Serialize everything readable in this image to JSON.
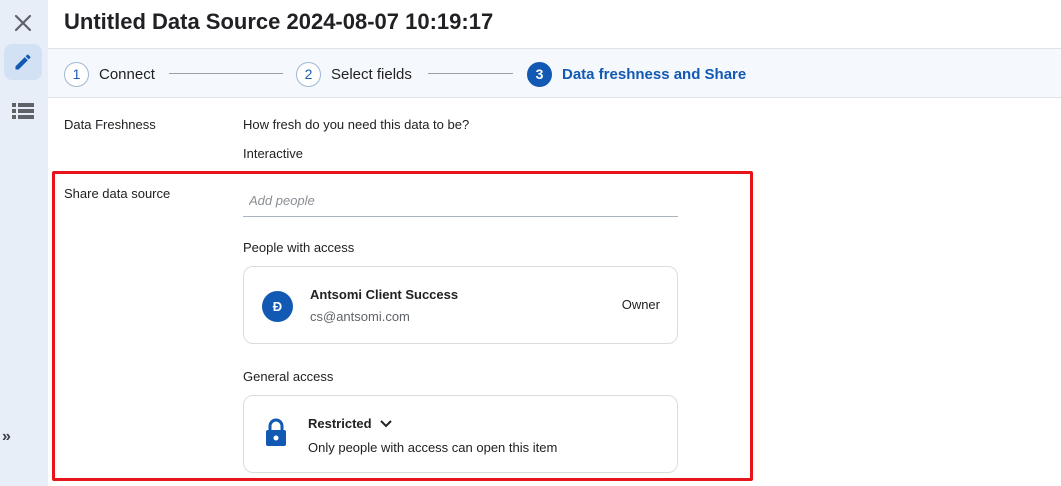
{
  "window": {
    "title": "Untitled Data Source 2024-08-07 10:19:17"
  },
  "rail": {
    "close_icon": "close-icon",
    "edit_icon": "pencil-icon",
    "list_icon": "list-icon",
    "expand_label": "»"
  },
  "stepper": {
    "steps": [
      {
        "number": "1",
        "label": "Connect",
        "active": false
      },
      {
        "number": "2",
        "label": "Select fields",
        "active": false
      },
      {
        "number": "3",
        "label": "Data freshness and Share",
        "active": true
      }
    ]
  },
  "freshness": {
    "label": "Data Freshness",
    "question": "How fresh do you need this data to be?",
    "value": "Interactive"
  },
  "share": {
    "label": "Share data source",
    "add_people_placeholder": "Add people",
    "people_heading": "People with access",
    "people": [
      {
        "avatar_letter": "Đ",
        "name": "Antsomi Client Success",
        "email": "cs@antsomi.com",
        "role": "Owner"
      }
    ],
    "general_heading": "General access",
    "general_access": {
      "level": "Restricted",
      "description": "Only people with access can open this item"
    }
  },
  "colors": {
    "accent": "#1259b3",
    "highlight": "#e8141b",
    "rail_bg": "#e8eef8"
  }
}
